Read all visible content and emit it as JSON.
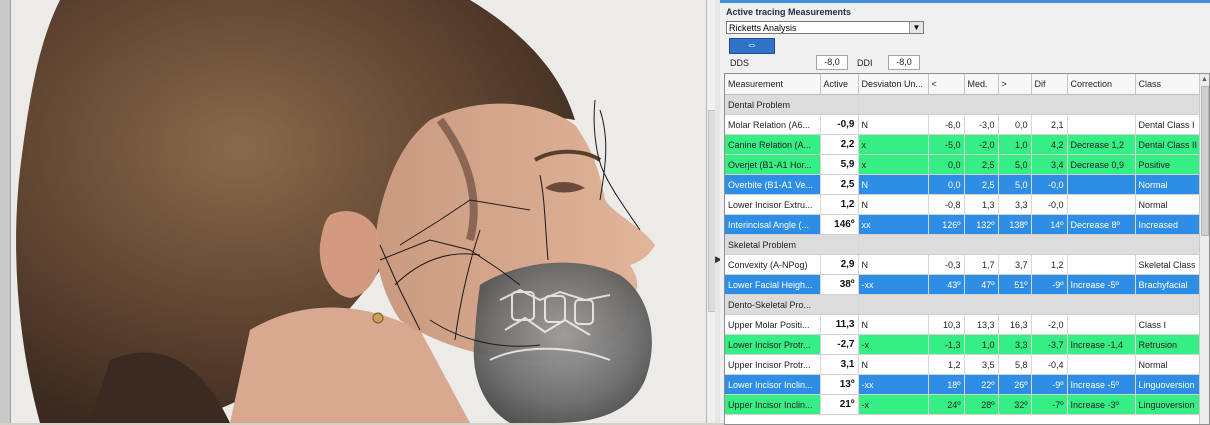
{
  "panel": {
    "section_title": "Active tracing Measurements",
    "analysis_selected": "Ricketts Analysis",
    "swap_icon": "⇔",
    "dds_label": "DDS",
    "dds_value": "-8,0",
    "ddi_label": "DDI",
    "ddi_value": "-8,0"
  },
  "colors": {
    "green_row": "#36ef84",
    "blue_row": "#2e8ee6",
    "group_row": "#dcdcdc",
    "accent": "#3c8fd8"
  },
  "table": {
    "headers": [
      "Measurement",
      "Active",
      "Desviaton Un...",
      "<",
      "Med.",
      ">",
      "Dif",
      "Correction",
      "Class"
    ],
    "rows": [
      {
        "type": "group",
        "label": "Dental Problem"
      },
      {
        "type": "white",
        "cells": [
          "Molar Relation (A6...",
          "-0,9",
          "N",
          "-6,0",
          "-3,0",
          "0,0",
          "2,1",
          "",
          "Dental Class I"
        ]
      },
      {
        "type": "green",
        "cells": [
          "Canine Relation (A...",
          "2,2",
          "x",
          "-5,0",
          "-2,0",
          "1,0",
          "4,2",
          "Decrease 1,2",
          "Dental Class II"
        ]
      },
      {
        "type": "green",
        "cells": [
          "Overjet (B1-A1 Hor...",
          "5,9",
          "x",
          "0,0",
          "2,5",
          "5,0",
          "3,4",
          "Decrease 0,9",
          "Positive"
        ]
      },
      {
        "type": "blue",
        "cells": [
          "Overbite (B1-A1 Ve...",
          "2,5",
          "N",
          "0,0",
          "2,5",
          "5,0",
          "-0,0",
          "",
          "Normal"
        ]
      },
      {
        "type": "white",
        "cells": [
          "Lower Incisor Extru...",
          "1,2",
          "N",
          "-0,8",
          "1,3",
          "3,3",
          "-0,0",
          "",
          "Normal"
        ]
      },
      {
        "type": "blue",
        "cells": [
          "Interincisal Angle (...",
          "146º",
          "xx",
          "126º",
          "132º",
          "138º",
          "14º",
          "Decrease  8º",
          "Increased"
        ]
      },
      {
        "type": "group",
        "label": "Skeletal Problem"
      },
      {
        "type": "white",
        "cells": [
          "Convexity (A-NPog)",
          "2,9",
          "N",
          "-0,3",
          "1,7",
          "3,7",
          "1,2",
          "",
          "Skeletal Class"
        ]
      },
      {
        "type": "blue",
        "cells": [
          "Lower Facial Heigh...",
          "38º",
          "-xx",
          "43º",
          "47º",
          "51º",
          "-9º",
          "Increase -5º",
          "Brachyfacial"
        ]
      },
      {
        "type": "group",
        "label": "Dento-Skeletal Pro..."
      },
      {
        "type": "white",
        "cells": [
          "Upper Molar Positi...",
          "11,3",
          "N",
          "10,3",
          "13,3",
          "16,3",
          "-2,0",
          "",
          "Class I"
        ]
      },
      {
        "type": "green",
        "cells": [
          "Lower Incisor Protr...",
          "-2,7",
          "-x",
          "-1,3",
          "1,0",
          "3,3",
          "-3,7",
          "Increase -1,4",
          "Retrusion"
        ]
      },
      {
        "type": "white",
        "cells": [
          "Upper Incisor Protr...",
          "3,1",
          "N",
          "1,2",
          "3,5",
          "5,8",
          "-0,4",
          "",
          "Normal"
        ]
      },
      {
        "type": "blue",
        "cells": [
          "Lower Incisor Inclin...",
          "13º",
          "-xx",
          "18º",
          "22º",
          "26º",
          "-9º",
          "Increase -5º",
          "Linguoversion"
        ]
      },
      {
        "type": "green",
        "cells": [
          "Upper Incisor Inclin...",
          "21º",
          "-x",
          "24º",
          "28º",
          "32º",
          "-7º",
          "Increase -3º",
          "Linguoversion"
        ]
      }
    ]
  }
}
